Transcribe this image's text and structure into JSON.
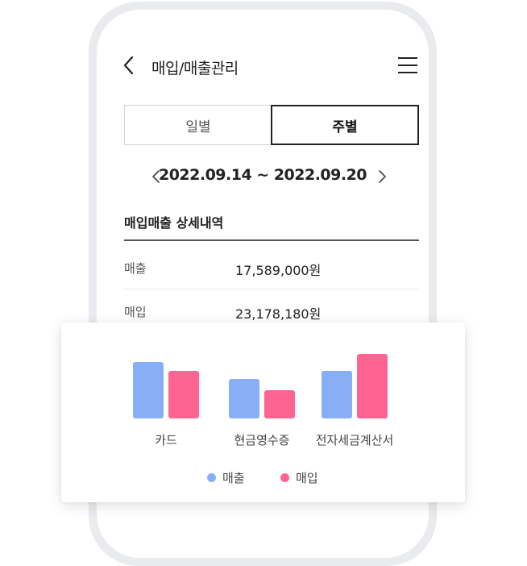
{
  "header": {
    "back_icon": "chevron-left-icon",
    "title": "매입/매출관리",
    "menu_icon": "hamburger-menu-icon"
  },
  "tabs": [
    {
      "label": "일별",
      "selected": false
    },
    {
      "label": "주별",
      "selected": true
    }
  ],
  "period": {
    "prev_icon": "chevron-left-icon",
    "text": "2022.09.14 ~ 2022.09.20",
    "next_icon": "chevron-right-icon"
  },
  "detail": {
    "title": "매입매출 상세내역",
    "rows": [
      {
        "label": "매출",
        "value": "17,589,000원"
      },
      {
        "label": "매입",
        "value": "23,178,180원"
      }
    ]
  },
  "colors": {
    "sales": "#89aef8",
    "purchase": "#fd6491"
  },
  "chart_data": {
    "type": "bar",
    "categories": [
      "카드",
      "현금영수증",
      "전자세금계산서"
    ],
    "series": [
      {
        "name": "매출",
        "values": [
          70,
          49,
          59
        ]
      },
      {
        "name": "매입",
        "values": [
          59,
          35,
          80
        ]
      }
    ],
    "title": "",
    "xlabel": "",
    "ylabel": "",
    "ylim": [
      0,
      100
    ],
    "grid": false,
    "legend": "bottom-center"
  }
}
